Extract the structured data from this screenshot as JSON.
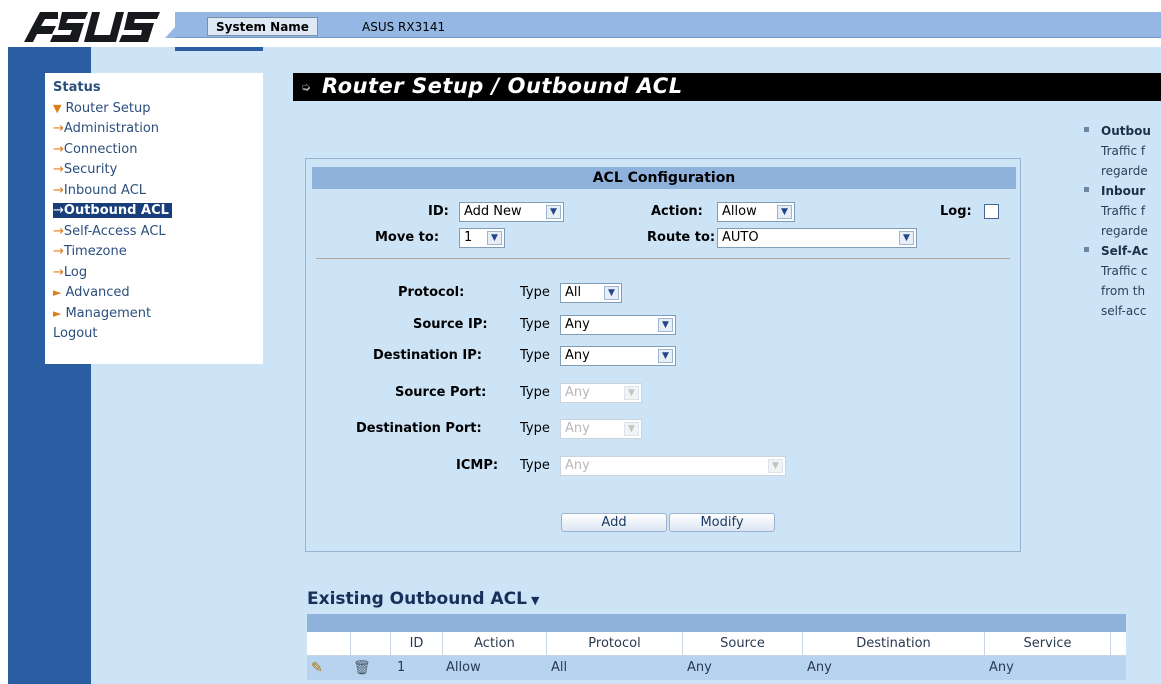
{
  "header": {
    "brand": "ASUS",
    "system_name_label": "System Name",
    "system_name_value": "ASUS RX3141"
  },
  "menu": {
    "items": [
      {
        "label": "Status",
        "kind": "top"
      },
      {
        "label": "Router Setup",
        "kind": "category"
      },
      {
        "label": "Administration",
        "kind": "sub"
      },
      {
        "label": "Connection",
        "kind": "sub"
      },
      {
        "label": "Security",
        "kind": "sub"
      },
      {
        "label": "Inbound ACL",
        "kind": "sub"
      },
      {
        "label": "Outbound ACL",
        "kind": "sub",
        "active": true
      },
      {
        "label": "Self-Access ACL",
        "kind": "sub"
      },
      {
        "label": "Timezone",
        "kind": "sub"
      },
      {
        "label": "Log",
        "kind": "sub"
      },
      {
        "label": "Advanced",
        "kind": "category"
      },
      {
        "label": "Management",
        "kind": "category"
      },
      {
        "label": "Logout",
        "kind": "top"
      }
    ]
  },
  "page": {
    "title": "Router Setup / Outbound ACL"
  },
  "acl_config": {
    "heading": "ACL Configuration",
    "id_label": "ID:",
    "id_value": "Add New",
    "action_label": "Action:",
    "action_value": "Allow",
    "log_label": "Log:",
    "log_checked": false,
    "move_to_label": "Move to:",
    "move_to_value": "1",
    "route_to_label": "Route to:",
    "route_to_value": "AUTO",
    "type_word": "Type",
    "protocol_label": "Protocol:",
    "protocol_value": "All",
    "source_ip_label": "Source IP:",
    "source_ip_value": "Any",
    "dest_ip_label": "Destination IP:",
    "dest_ip_value": "Any",
    "source_port_label": "Source Port:",
    "source_port_value": "Any",
    "dest_port_label": "Destination Port:",
    "dest_port_value": "Any",
    "icmp_label": "ICMP:",
    "icmp_value": "Any",
    "add_button": "Add",
    "modify_button": "Modify"
  },
  "help": {
    "items": [
      {
        "title": "Outbou",
        "lines": [
          "Traffic f",
          "regarde"
        ]
      },
      {
        "title": "Inbour",
        "lines": [
          "Traffic f",
          "regarde"
        ]
      },
      {
        "title": "Self-Ac",
        "lines": [
          "Traffic c",
          "from th",
          "self-acc"
        ]
      }
    ]
  },
  "existing": {
    "title": "Existing Outbound ACL",
    "columns": [
      "",
      "",
      "ID",
      "Action",
      "Protocol",
      "Source",
      "Destination",
      "Service"
    ],
    "rows": [
      {
        "id": "1",
        "action": "Allow",
        "protocol": "All",
        "source": "Any",
        "destination": "Any",
        "service": "Any"
      }
    ]
  },
  "colors": {
    "page_bg": "#cde4f7",
    "header_bar": "#94b8e3",
    "nav_dark": "#2b5da3",
    "section_head": "#8fb2dd",
    "accent_orange": "#e07b17"
  },
  "icons": {
    "title": "arrow-bullet-icon",
    "category": "triangle-right-icon",
    "sub": "arrow-right-icon",
    "dropdown": "chevron-down-icon",
    "edit": "pencil-icon",
    "delete": "trash-icon"
  }
}
